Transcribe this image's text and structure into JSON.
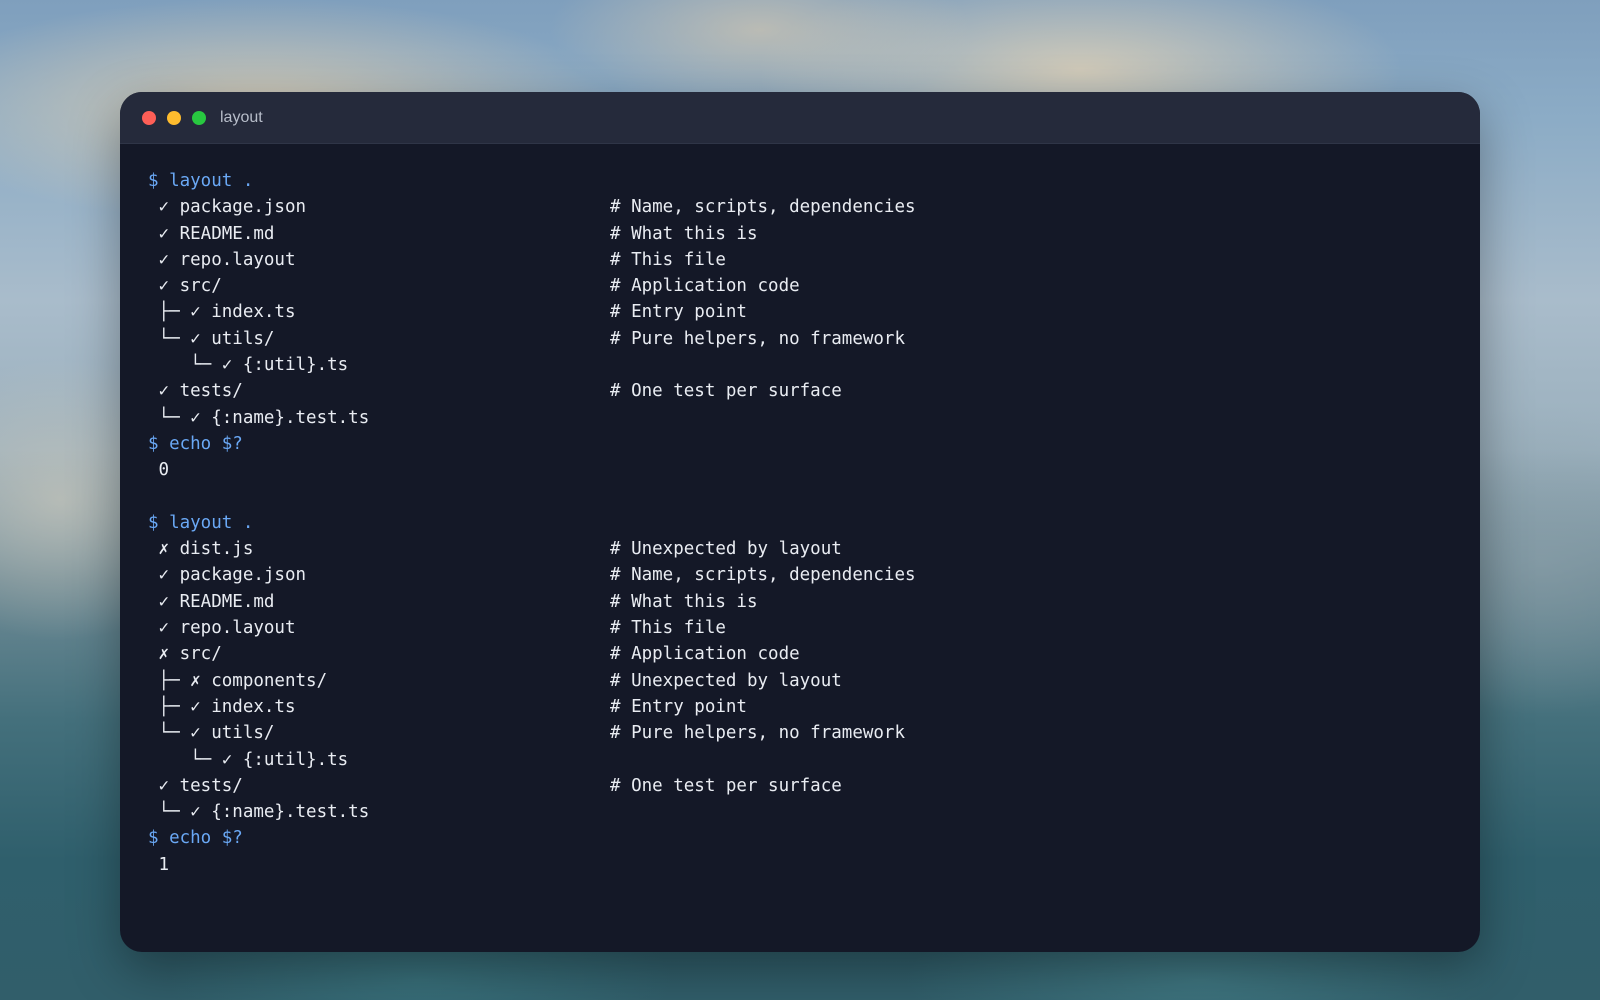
{
  "window": {
    "title": "layout",
    "buttons": [
      "close",
      "minimize",
      "maximize"
    ]
  },
  "colors": {
    "prompt": "#6aa8f5",
    "text": "#e9ecf2",
    "background": "#141827",
    "titlebar": "#252a3b"
  },
  "session": [
    {
      "type": "prompt",
      "text": "$ layout ."
    },
    {
      "type": "entry",
      "path": " ✓ package.json",
      "comment": "# Name, scripts, dependencies"
    },
    {
      "type": "entry",
      "path": " ✓ README.md",
      "comment": "# What this is"
    },
    {
      "type": "entry",
      "path": " ✓ repo.layout",
      "comment": "# This file"
    },
    {
      "type": "entry",
      "path": " ✓ src/",
      "comment": "# Application code"
    },
    {
      "type": "entry",
      "path": " ├─ ✓ index.ts",
      "comment": "# Entry point"
    },
    {
      "type": "entry",
      "path": " └─ ✓ utils/",
      "comment": "# Pure helpers, no framework"
    },
    {
      "type": "entry",
      "path": "    └─ ✓ {:util}.ts",
      "comment": ""
    },
    {
      "type": "entry",
      "path": " ✓ tests/",
      "comment": "# One test per surface"
    },
    {
      "type": "entry",
      "path": " └─ ✓ {:name}.test.ts",
      "comment": ""
    },
    {
      "type": "prompt",
      "text": "$ echo $?"
    },
    {
      "type": "output",
      "text": " 0"
    },
    {
      "type": "blank",
      "text": ""
    },
    {
      "type": "prompt",
      "text": "$ layout ."
    },
    {
      "type": "entry",
      "path": " ✗ dist.js",
      "comment": "# Unexpected by layout"
    },
    {
      "type": "entry",
      "path": " ✓ package.json",
      "comment": "# Name, scripts, dependencies"
    },
    {
      "type": "entry",
      "path": " ✓ README.md",
      "comment": "# What this is"
    },
    {
      "type": "entry",
      "path": " ✓ repo.layout",
      "comment": "# This file"
    },
    {
      "type": "entry",
      "path": " ✗ src/",
      "comment": "# Application code"
    },
    {
      "type": "entry",
      "path": " ├─ ✗ components/",
      "comment": "# Unexpected by layout"
    },
    {
      "type": "entry",
      "path": " ├─ ✓ index.ts",
      "comment": "# Entry point"
    },
    {
      "type": "entry",
      "path": " └─ ✓ utils/",
      "comment": "# Pure helpers, no framework"
    },
    {
      "type": "entry",
      "path": "    └─ ✓ {:util}.ts",
      "comment": ""
    },
    {
      "type": "entry",
      "path": " ✓ tests/",
      "comment": "# One test per surface"
    },
    {
      "type": "entry",
      "path": " └─ ✓ {:name}.test.ts",
      "comment": ""
    },
    {
      "type": "prompt",
      "text": "$ echo $?"
    },
    {
      "type": "output",
      "text": " 1"
    }
  ]
}
